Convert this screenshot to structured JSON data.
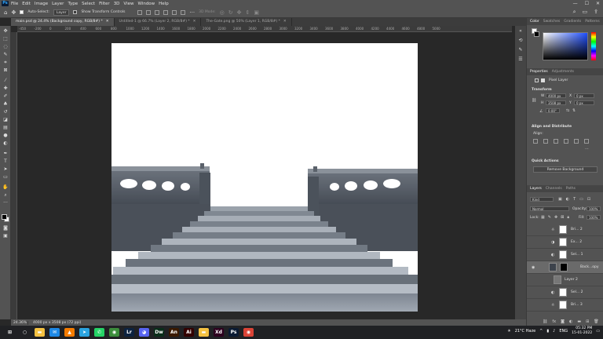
{
  "menubar": {
    "app_logo": "Ps",
    "items": [
      "File",
      "Edit",
      "Image",
      "Layer",
      "Type",
      "Select",
      "Filter",
      "3D",
      "View",
      "Window",
      "Help"
    ],
    "window_controls": [
      "—",
      "☐",
      "✕"
    ]
  },
  "options_bar": {
    "auto_select_label": "Auto-Select:",
    "auto_select_target": "Layer",
    "transform_controls_label": "Show Transform Controls",
    "mode_3d_label": "3D Mode:"
  },
  "tabs": [
    {
      "label": "main.psd @ 24.4% (Background copy, RGB/8#) *",
      "active": true
    },
    {
      "label": "Untitled-1 @ 66.7% (Layer 2, RGB/8#) *",
      "active": false
    },
    {
      "label": "The-Gate.png @ 50% (Layer 1, RGB/8#) *",
      "active": false
    }
  ],
  "ruler_ticks": [
    "-450",
    "-200",
    "0",
    "200",
    "400",
    "600",
    "800",
    "1000",
    "1200",
    "1400",
    "1600",
    "1800",
    "2000",
    "2200",
    "2400",
    "2600",
    "2800",
    "3000",
    "3200",
    "3400",
    "3600",
    "3800",
    "4000",
    "4200",
    "4400",
    "4600",
    "4800",
    "5000"
  ],
  "statusbar": {
    "zoom": "24.36%",
    "doc_info": "4000 px x 3508 px (72 ppi)"
  },
  "panels": {
    "color_tabs": [
      "Color",
      "Swatches",
      "Gradients",
      "Patterns"
    ],
    "properties_tabs": [
      "Properties",
      "Adjustments"
    ],
    "pixel_layer_label": "Pixel Layer",
    "transform": {
      "title": "Transform",
      "w_label": "W",
      "w_value": "4000 px",
      "h_label": "H",
      "h_value": "3508 px",
      "x_label": "X",
      "x_value": "0 px",
      "y_label": "Y",
      "y_value": "0 px",
      "angle_value": "0.00°"
    },
    "align": {
      "title": "Align and Distribute",
      "align_label": "Align:"
    },
    "quick_actions": {
      "title": "Quick Actions",
      "remove_bg_label": "Remove Background"
    },
    "layers_tabs": [
      "Layers",
      "Channels",
      "Paths"
    ],
    "kind_label": "Kind",
    "blend_mode": "Normal",
    "opacity_label": "Opacity:",
    "opacity_value": "100%",
    "lock_label": "Lock:",
    "fill_label": "Fill:",
    "fill_value": "100%",
    "layers": [
      {
        "name": "Bri... 2",
        "visible": false,
        "mask": true
      },
      {
        "name": "Ex... 2",
        "visible": false,
        "mask": true
      },
      {
        "name": "Sel... 1",
        "visible": false,
        "mask": true
      },
      {
        "name": "Back...opy",
        "visible": true,
        "mask": false,
        "selected": true
      },
      {
        "name": "Layer 2",
        "visible": false,
        "mask": false
      },
      {
        "name": "Sel... 2",
        "visible": false,
        "mask": true
      },
      {
        "name": "Bri... 3",
        "visible": false,
        "mask": true
      }
    ]
  },
  "taskbar": {
    "weather": "21°C Haze",
    "language": "ENG",
    "time": "05:32 PM",
    "date": "15-01-2022",
    "apps": [
      {
        "name": "start",
        "glyph": "⊞",
        "color": "#202124"
      },
      {
        "name": "search",
        "glyph": "○",
        "color": "#202124"
      },
      {
        "name": "explorer",
        "glyph": "▬",
        "color": "#f5c242"
      },
      {
        "name": "mail",
        "glyph": "✉",
        "color": "#1e88e5"
      },
      {
        "name": "vlc",
        "glyph": "▲",
        "color": "#f57c00"
      },
      {
        "name": "telegram",
        "glyph": "➤",
        "color": "#2aa3df"
      },
      {
        "name": "whatsapp",
        "glyph": "✆",
        "color": "#25d366"
      },
      {
        "name": "chrome",
        "glyph": "◉",
        "color": "#3c8d3c"
      },
      {
        "name": "lightroom",
        "glyph": "Lr",
        "color": "#0d2340"
      },
      {
        "name": "discord",
        "glyph": "◕",
        "color": "#5865f2"
      },
      {
        "name": "dreamweaver",
        "glyph": "Dw",
        "color": "#0a2e1a"
      },
      {
        "name": "animate",
        "glyph": "An",
        "color": "#3a1a00"
      },
      {
        "name": "illustrator",
        "glyph": "Ai",
        "color": "#330000"
      },
      {
        "name": "files",
        "glyph": "▬",
        "color": "#f5c242"
      },
      {
        "name": "xd",
        "glyph": "Xd",
        "color": "#2e001f"
      },
      {
        "name": "photoshop",
        "glyph": "Ps",
        "color": "#0b1b33"
      },
      {
        "name": "chrome-2",
        "glyph": "◉",
        "color": "#db4437"
      }
    ]
  },
  "colors": {
    "ps_blue": "#31a8ff",
    "panel_bg": "#535353",
    "canvas_bg": "#282828"
  }
}
